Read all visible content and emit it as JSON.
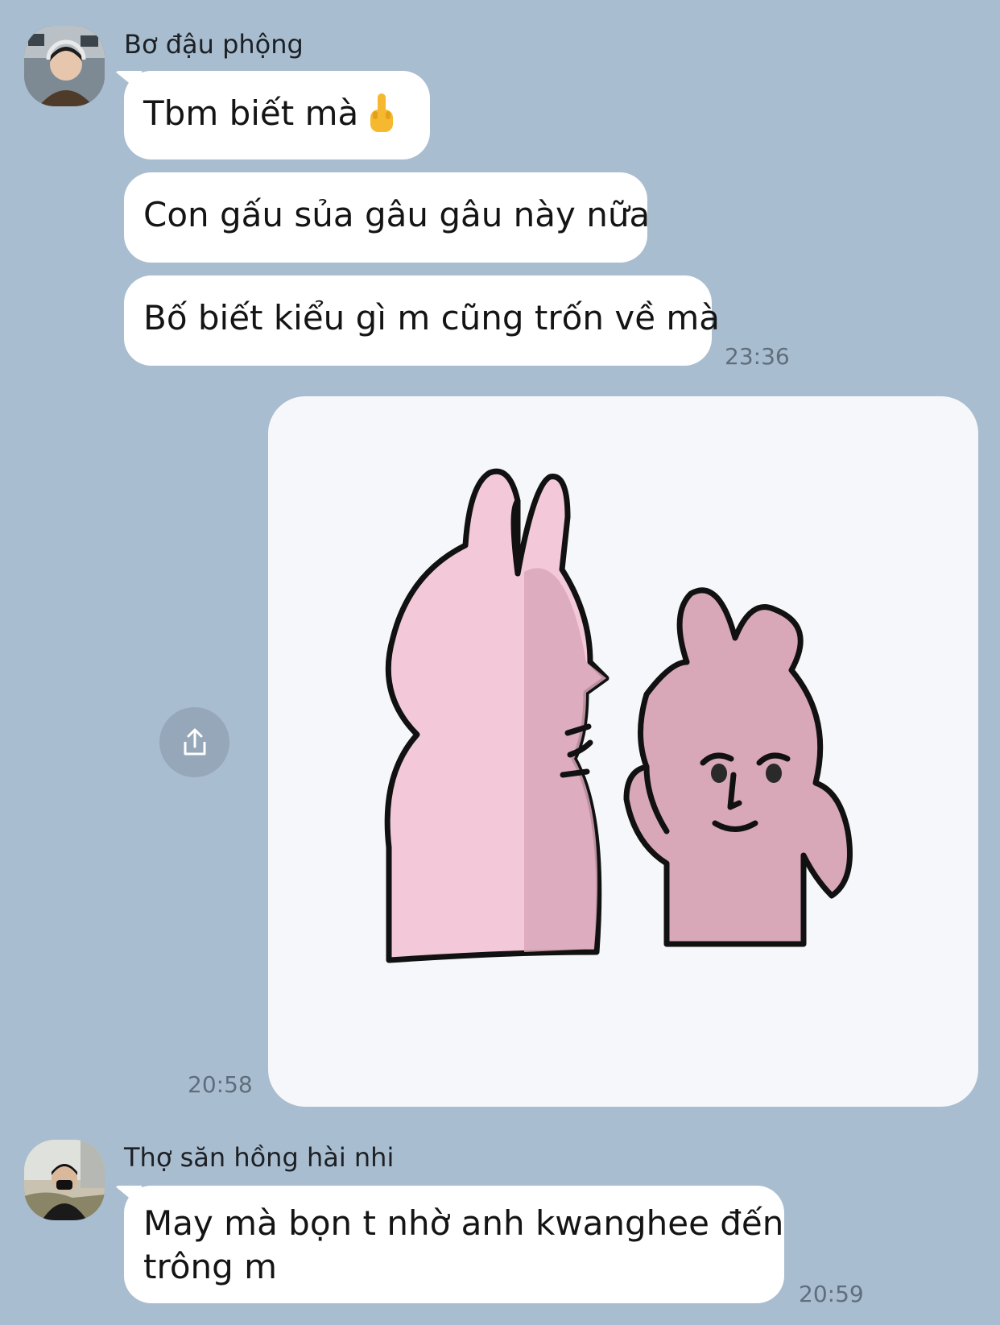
{
  "messages": {
    "group1": {
      "sender": "Bơ đậu phộng",
      "bubble1": "Tbm biết mà",
      "bubble1_emoji": "middle-finger-emoji",
      "bubble2": "Con gấu sủa gâu gâu này nữa",
      "bubble3": "Bố biết kiểu gì m cũng trốn về mà",
      "time": "23:36"
    },
    "sticker": {
      "time": "20:58",
      "icon": "share-icon",
      "description_icons": [
        "pink-rabbit-sticker"
      ]
    },
    "group2": {
      "sender": "Thợ săn hồng hài nhi",
      "bubble1_line1": "May mà bọn t nhờ anh kwanghee đến",
      "bubble1_line2": "trông m",
      "time": "20:59"
    }
  },
  "colors": {
    "background": "#a9bdd0",
    "bubble": "#ffffff",
    "sticker_bg": "#f6f7fa",
    "rabbit_pink": "#f2c9d8",
    "rabbit_shadow": "#d7a8b7"
  }
}
